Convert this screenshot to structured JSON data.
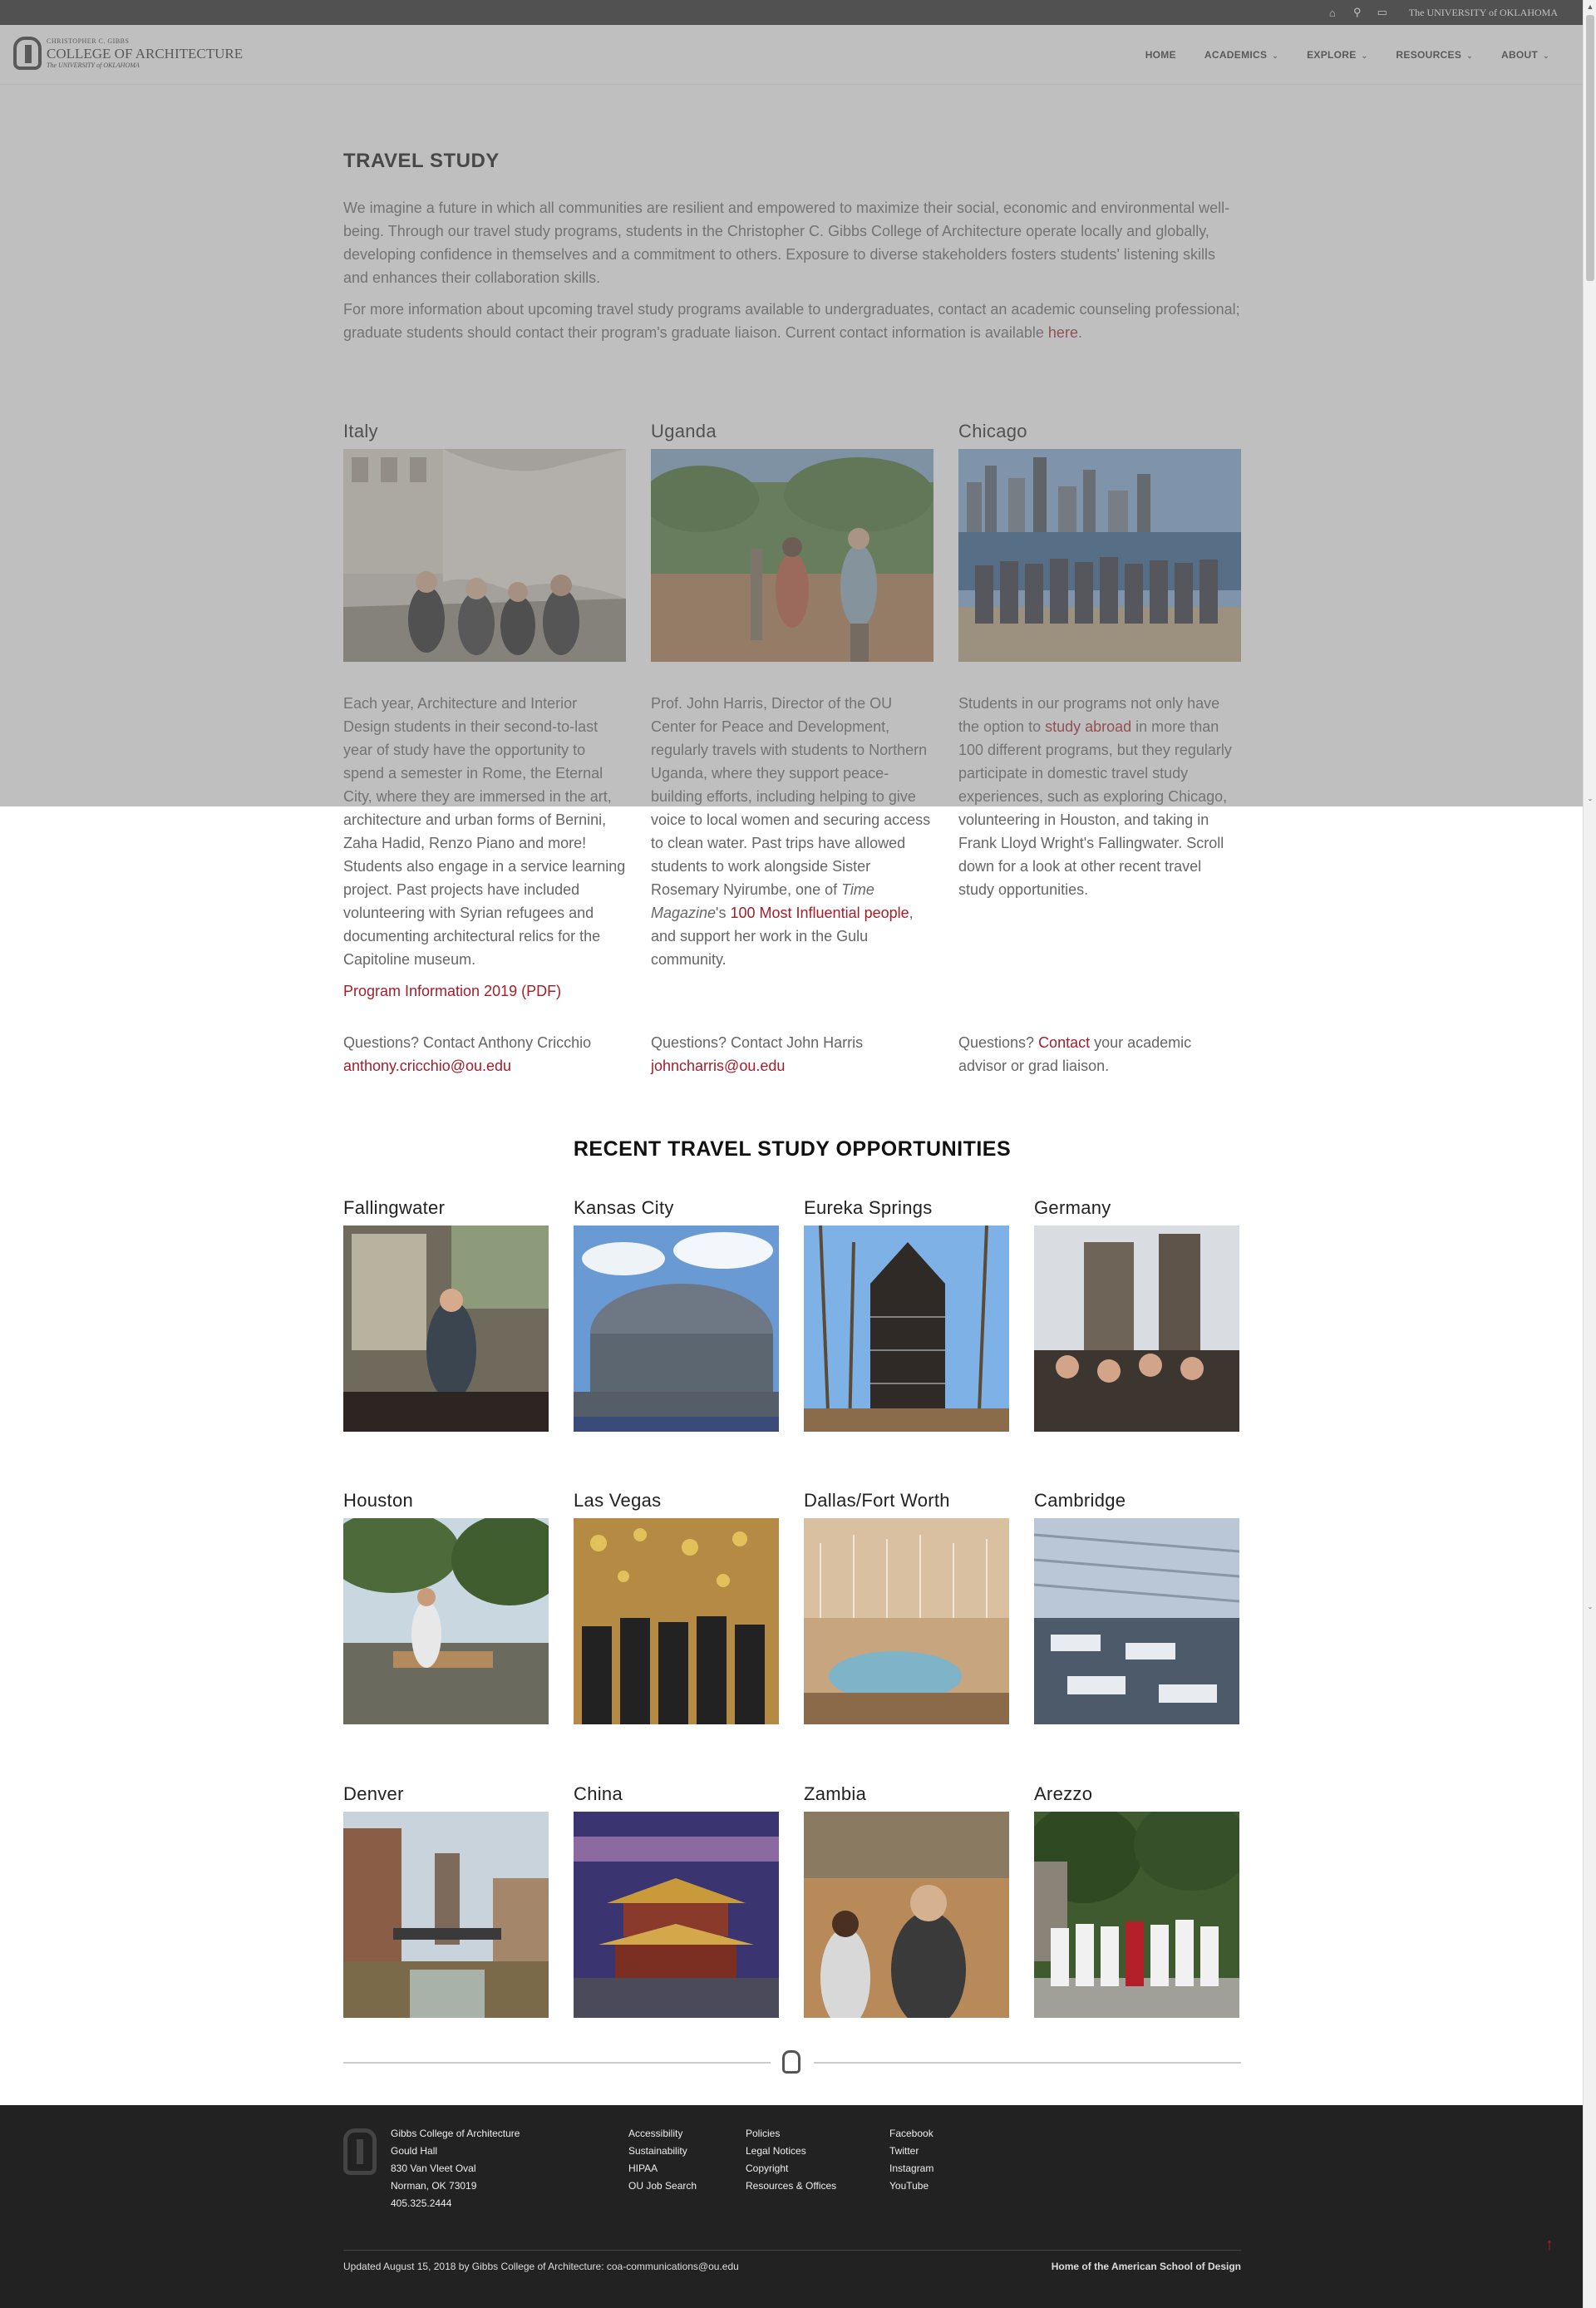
{
  "topbar": {
    "university": "The UNIVERSITY of OKLAHOMA"
  },
  "logo": {
    "line1": "CHRISTOPHER C. GIBBS",
    "line2": "COLLEGE OF ARCHITECTURE",
    "line3": "The UNIVERSITY of OKLAHOMA"
  },
  "nav": [
    "HOME",
    "ACADEMICS",
    "EXPLORE",
    "RESOURCES",
    "ABOUT"
  ],
  "page": {
    "title": "TRAVEL STUDY",
    "intro1": "We imagine a future in which all communities are resilient and empowered to maximize their social, economic and environmental well-being. Through our travel study programs, students in the Christopher C. Gibbs College of Architecture operate locally and globally, developing confidence in themselves and a commitment to others. Exposure to diverse stakeholders fosters students' listening skills and enhances their collaboration skills.",
    "intro2_pre": "For more information about upcoming travel study programs available to undergraduates, contact an academic counseling professional; graduate students should contact their program's graduate liaison. Current contact information is available ",
    "intro2_link": "here",
    "intro2_post": "."
  },
  "programs": {
    "italy": {
      "title": "Italy",
      "desc": "Each year, Architecture and Interior Design students in their second-to-last year of study have the opportunity to spend a semester in Rome, the Eternal City, where they are immersed in the art, architecture and urban forms of Bernini, Zaha Hadid, Renzo Piano and more! Students also engage in a service learning project. Past projects have included volunteering with Syrian refugees and documenting architectural relics for the Capitoline museum.",
      "program_link": "Program Information 2019 (PDF)",
      "question": "Questions? Contact Anthony Cricchio",
      "email": "anthony.cricchio@ou.edu"
    },
    "uganda": {
      "title": "Uganda",
      "desc_pre": "Prof. John Harris, Director of the OU Center for Peace and Development, regularly travels with students to Northern Uganda, where they support peace-building efforts, including helping to give voice to local women and securing access to clean water. Past trips have allowed students to work alongside Sister Rosemary Nyirumbe, one of ",
      "desc_italic": "Time Magazine",
      "desc_mid": "'s ",
      "desc_link": "100 Most Influential people",
      "desc_post": ", and support her work in the Gulu community.",
      "question": "Questions? Contact John Harris",
      "email": "johncharris@ou.edu"
    },
    "chicago": {
      "title": "Chicago",
      "desc_pre": "Students in our programs not only have the option to ",
      "desc_link": "study abroad",
      "desc_post": "  in more than 100 different programs, but they regularly participate in domestic travel study experiences, such as exploring Chicago, volunteering in Houston, and taking in Frank Lloyd Wright's Fallingwater. Scroll down for a look at other recent travel study opportunities.",
      "question_pre": "Questions? ",
      "question_link": "Contact",
      "question_post": " your academic advisor or grad liaison."
    }
  },
  "recent": {
    "title": "RECENT TRAVEL STUDY OPPORTUNITIES",
    "items": [
      "Fallingwater",
      "Kansas City",
      "Eureka Springs",
      "Germany",
      "Houston",
      "Las Vegas",
      "Dallas/Fort Worth",
      "Cambridge",
      "Denver",
      "China",
      "Zambia",
      "Arezzo"
    ]
  },
  "footer": {
    "address": [
      "Gibbs College of Architecture",
      "Gould Hall",
      "830 Van Vleet Oval",
      "Norman, OK 73019",
      "405.325.2444"
    ],
    "col1": [
      "Accessibility",
      "Sustainability",
      "HIPAA",
      "OU Job Search"
    ],
    "col2": [
      "Policies",
      "Legal Notices",
      "Copyright",
      "Resources & Offices"
    ],
    "col3": [
      "Facebook",
      "Twitter",
      "Instagram",
      "YouTube"
    ],
    "updated": "Updated August 15, 2018 by Gibbs College of Architecture: coa-communications@ou.edu",
    "tagline": "Home of the American School of Design"
  },
  "colors": {
    "accent": "#a11f2b",
    "dark": "#222222"
  },
  "icons": [
    "home-icon",
    "search-icon",
    "chat-icon",
    "back-to-top-icon"
  ]
}
